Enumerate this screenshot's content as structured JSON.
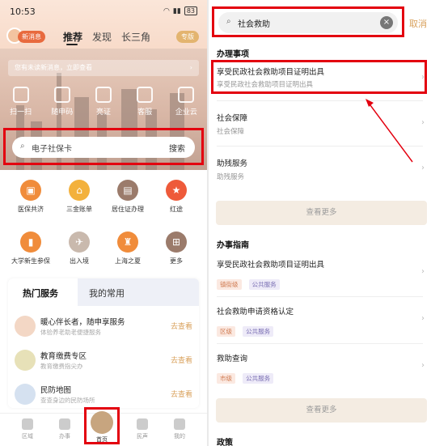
{
  "left_screen": {
    "status": {
      "time": "10:53",
      "battery": "83"
    },
    "header": {
      "new_message": "新消息",
      "tabs": [
        "推荐",
        "发现",
        "长三角"
      ],
      "active_tab": "推荐",
      "pill": "专版"
    },
    "notice": {
      "text": "您有未读新消息，立即查看",
      "arrow": "›"
    },
    "quick_actions": [
      "扫一扫",
      "随申码",
      "亮证",
      "客服",
      "企业云"
    ],
    "search": {
      "placeholder": "电子社保卡",
      "button": "搜索",
      "icon": "search-icon"
    },
    "grid": [
      {
        "label": "医保共济",
        "color": "#f08c3b",
        "glyph": "▣"
      },
      {
        "label": "三金账单",
        "color": "#f3b13c",
        "glyph": "⌂"
      },
      {
        "label": "居住证办理",
        "color": "#9b7b6b",
        "glyph": "▤"
      },
      {
        "label": "红途",
        "color": "#ee5a3a",
        "glyph": "★"
      },
      {
        "label": "大学新生参保",
        "color": "#f08c3b",
        "glyph": "▮"
      },
      {
        "label": "出入境",
        "color": "#c9b9ad",
        "glyph": "✈"
      },
      {
        "label": "上海之夏",
        "color": "#f08c3b",
        "glyph": "♜"
      },
      {
        "label": "更多",
        "color": "#9b7b6b",
        "glyph": "⊞"
      }
    ],
    "services": {
      "tabs": [
        "热门服务",
        "我的常用"
      ],
      "items": [
        {
          "title": "暖心伴长者，随申享服务",
          "subtitle": "体验养老助老便捷服务",
          "action": "去查看"
        },
        {
          "title": "教育缴费专区",
          "subtitle": "教育缴费指尖办",
          "action": "去查看"
        },
        {
          "title": "民防地图",
          "subtitle": "查查身边的民防场所",
          "action": "去查看"
        }
      ]
    },
    "bottom_nav": [
      "区域",
      "办事",
      "首页",
      "民声",
      "我的"
    ]
  },
  "right_screen": {
    "search": {
      "value": "社会救助",
      "cancel": "取消"
    },
    "section_affairs": "办理事项",
    "affairs": [
      {
        "title": "享受民政社会救助项目证明出具",
        "subtitle": "享受民政社会救助项目证明出具"
      },
      {
        "title": "社会保障",
        "subtitle": "社会保障"
      },
      {
        "title": "助残服务",
        "subtitle": "助残服务"
      }
    ],
    "more1": "查看更多",
    "section_guide": "办事指南",
    "guides": [
      {
        "title": "享受民政社会救助项目证明出具",
        "level": "镇街级",
        "scope": "公共服务"
      },
      {
        "title": "社会救助申请资格认定",
        "level": "区级",
        "scope": "公共服务"
      },
      {
        "title": "救助查询",
        "level": "市级",
        "scope": "公共服务"
      }
    ],
    "more2": "查看更多",
    "section_policy": "政策"
  },
  "colors": {
    "highlight": "#e3000f",
    "accent": "#d9a15c"
  }
}
